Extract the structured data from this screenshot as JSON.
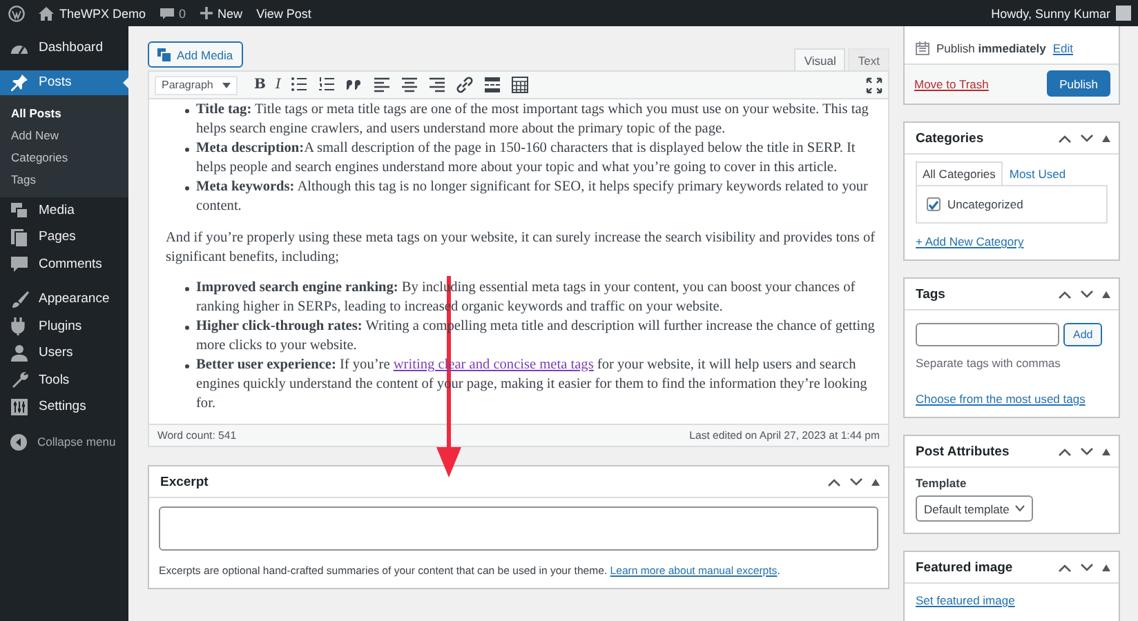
{
  "admin_bar": {
    "site_name": "TheWPX Demo",
    "comments_count": "0",
    "new_label": "New",
    "view_post": "View Post",
    "greeting": "Howdy, Sunny Kumar"
  },
  "sidebar": {
    "groups": [
      [
        {
          "kind": "dashboard",
          "label": "Dashboard",
          "selected": false
        }
      ],
      [
        {
          "kind": "posts",
          "label": "Posts",
          "selected": true,
          "children": [
            {
              "label": "All Posts",
              "selected": true
            },
            {
              "label": "Add New",
              "selected": false
            },
            {
              "label": "Categories",
              "selected": false
            },
            {
              "label": "Tags",
              "selected": false
            }
          ]
        },
        {
          "kind": "media",
          "label": "Media",
          "selected": false
        },
        {
          "kind": "pages",
          "label": "Pages",
          "selected": false
        },
        {
          "kind": "comments",
          "label": "Comments",
          "selected": false
        }
      ],
      [
        {
          "kind": "appearance",
          "label": "Appearance",
          "selected": false
        },
        {
          "kind": "plugins",
          "label": "Plugins",
          "selected": false
        },
        {
          "kind": "users",
          "label": "Users",
          "selected": false
        },
        {
          "kind": "tools",
          "label": "Tools",
          "selected": false
        },
        {
          "kind": "settings",
          "label": "Settings",
          "selected": false
        }
      ]
    ],
    "collapse": "Collapse menu"
  },
  "editor": {
    "add_media": "Add Media",
    "tabs": [
      {
        "label": "Visual",
        "selected": true
      },
      {
        "label": "Text",
        "selected": false
      }
    ],
    "format_select": "Paragraph",
    "toolbar": [
      {
        "kind": "bold",
        "glyph": "B"
      },
      {
        "kind": "italic",
        "glyph": "I"
      },
      {
        "kind": "bullet-list"
      },
      {
        "kind": "numbered-list"
      },
      {
        "kind": "blockquote"
      },
      {
        "kind": "align-left"
      },
      {
        "kind": "align-center"
      },
      {
        "kind": "align-right"
      },
      {
        "kind": "link"
      },
      {
        "kind": "read-more"
      },
      {
        "kind": "toolbar-toggle"
      }
    ],
    "content": [
      {
        "kind": "list",
        "items": [
          {
            "text": "**Title tag:** Title tags or meta title tags are one of the most important tags which you must use on your website. This tag helps search engine crawlers, and users understand more about the primary topic of the page."
          },
          {
            "text": "**Meta description:**A small description of the page in 150-160 characters that is displayed below the title in SERP. It helps people and search engines understand more about your topic and what you’re going to cover in this article."
          },
          {
            "text": "**Meta keywords:** Although this tag is no longer significant for SEO, it helps specify primary keywords related to your content."
          }
        ]
      },
      {
        "kind": "paragraph",
        "text": "And if you’re properly using these meta tags on your website, it can surely increase the search visibility and provides tons of significant benefits, including;"
      },
      {
        "kind": "list",
        "items": [
          {
            "text": "**Improved search engine ranking:** By including essential meta tags in your content, you can boost your chances of ranking higher in SERPs, leading to increased organic keywords and traffic on your website."
          },
          {
            "text": "**Higher click-through rates:** Writing a compelling meta title and description will further increase the chance of getting more clicks to your website."
          },
          {
            "text": "**Better user experience:** If you’re ",
            "link": "writing clear and concise meta tags",
            "text_after": " for your website, it will help users and search engines quickly understand the content of your page, making it easier for them to find the information they’re looking for."
          }
        ]
      }
    ],
    "word_count": "Word count: 541",
    "last_edited": "Last edited on April 27, 2023 at 1:44 pm"
  },
  "excerpt": {
    "title": "Excerpt",
    "help": "Excerpts are optional hand-crafted summaries of your content that can be used in your theme. ",
    "help_link": "Learn more about manual excerpts",
    "help_after": "."
  },
  "publish": {
    "schedule": "Publish **immediately**",
    "edit": "Edit",
    "trash": "Move to Trash",
    "button": "Publish"
  },
  "categories": {
    "title": "Categories",
    "tabs": [
      {
        "label": "All Categories",
        "selected": true
      },
      {
        "label": "Most Used",
        "selected": false
      }
    ],
    "items": [
      {
        "label": "Uncategorized",
        "checked": true
      }
    ],
    "add_new": "+ Add New Category"
  },
  "tags": {
    "title": "Tags",
    "button": "Add",
    "hint": "Separate tags with commas",
    "choose": "Choose from the most used tags"
  },
  "post_attributes": {
    "title": "Post Attributes",
    "template_label": "Template",
    "template_value": "Default template"
  },
  "featured_image": {
    "title": "Featured image",
    "link": "Set featured image"
  }
}
